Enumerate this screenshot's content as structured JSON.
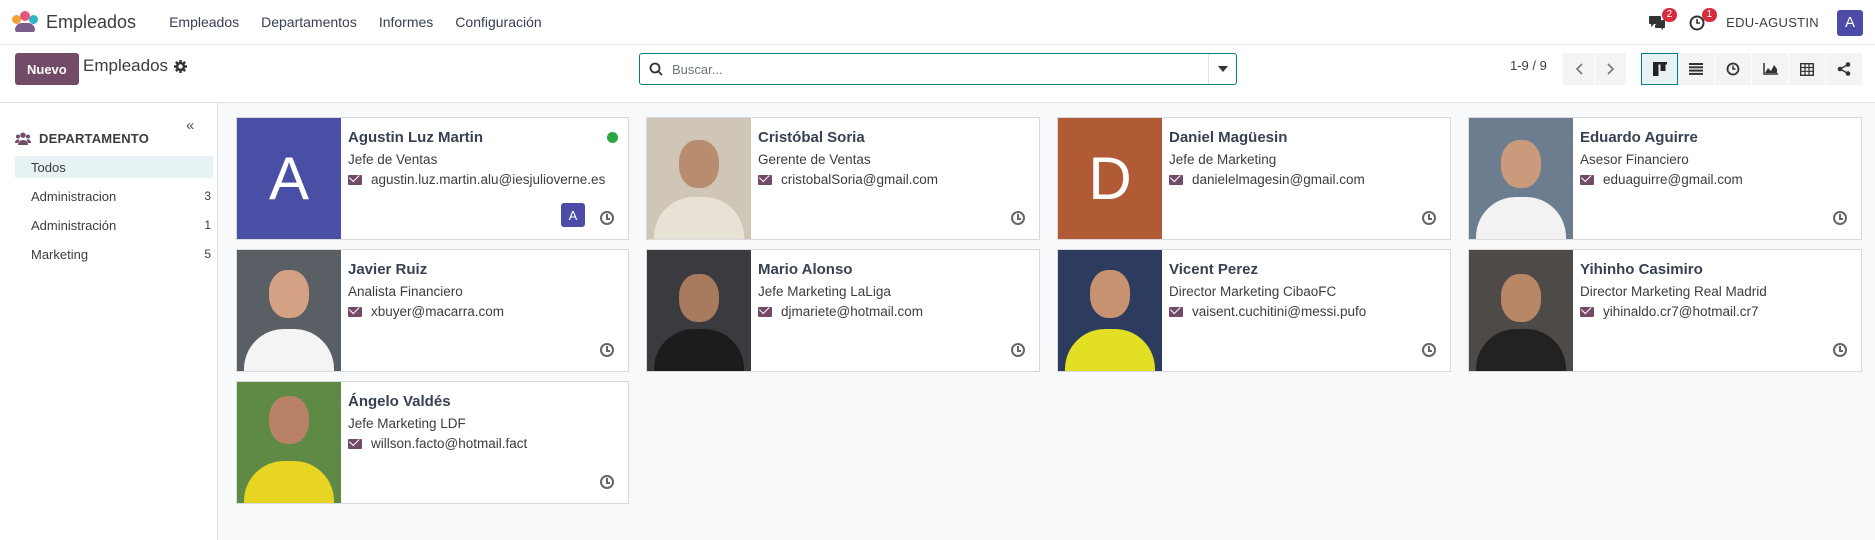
{
  "app": {
    "name": "Empleados"
  },
  "menu": [
    "Empleados",
    "Departamentos",
    "Informes",
    "Configuración"
  ],
  "systray": {
    "messages_badge": "2",
    "activity_badge": "1",
    "company": "EDU-AGUSTIN",
    "user_initial": "A"
  },
  "control": {
    "new_label": "Nuevo",
    "breadcrumb": "Empleados",
    "search_placeholder": "Buscar...",
    "pager": "1-9 / 9"
  },
  "sidebar": {
    "title": "DEPARTAMENTO",
    "items": [
      {
        "label": "Todos",
        "count": ""
      },
      {
        "label": "Administracion",
        "count": "3"
      },
      {
        "label": "Administración",
        "count": "1"
      },
      {
        "label": "Marketing",
        "count": "5"
      }
    ]
  },
  "employees": [
    {
      "name": "Agustin Luz Martin",
      "job": "Jefe de Ventas",
      "email": "agustin.luz.martin.alu@iesjulioverne.es",
      "initial": "A",
      "photo_color": "#4a4fa6",
      "online": true,
      "user_initial": "A"
    },
    {
      "name": "Cristóbal Soria",
      "job": "Gerente de Ventas",
      "email": "cristobalSoria@gmail.com",
      "photo_color": "#cfc6b8"
    },
    {
      "name": "Daniel Magüesin",
      "job": "Jefe de Marketing",
      "email": "danielelmagesin@gmail.com",
      "initial": "D",
      "photo_color": "#b05b35"
    },
    {
      "name": "Eduardo Aguirre",
      "job": "Asesor Financiero",
      "email": "eduaguirre@gmail.com",
      "photo_color": "#6b7d8f"
    },
    {
      "name": "Javier Ruiz",
      "job": "Analista Financiero",
      "email": "xbuyer@macarra.com",
      "photo_color": "#5a5f66"
    },
    {
      "name": "Mario Alonso",
      "job": "Jefe Marketing LaLiga",
      "email": "djmariete@hotmail.com",
      "photo_color": "#3a3a3f"
    },
    {
      "name": "Vicent Perez",
      "job": "Director Marketing CibaoFC",
      "email": "vaisent.cuchitini@messi.pufo",
      "photo_color": "#2d3b5e"
    },
    {
      "name": "Yihinho Casimiro",
      "job": "Director Marketing Real Madrid",
      "email": "yihinaldo.cr7@hotmail.cr7",
      "photo_color": "#4e4a47"
    },
    {
      "name": "Ángelo Valdés",
      "job": "Jefe Marketing LDF",
      "email": "willson.facto@hotmail.fact",
      "photo_color": "#5f8a45"
    }
  ]
}
